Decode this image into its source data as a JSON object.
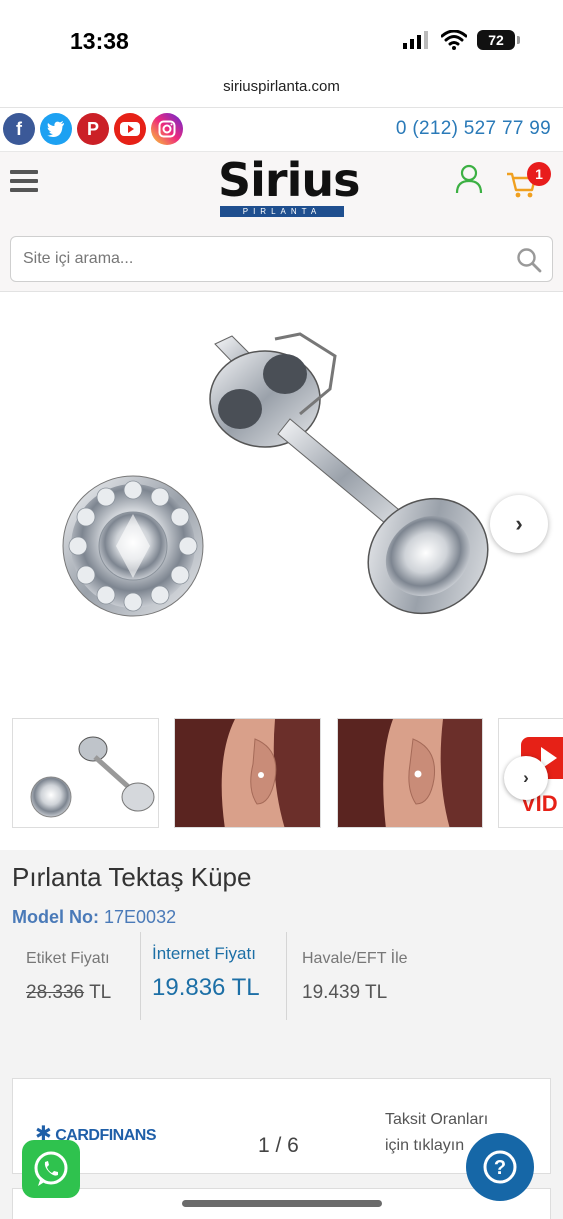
{
  "status": {
    "time": "13:38",
    "battery": "72"
  },
  "browser": {
    "url": "siriuspirlanta.com"
  },
  "topbar": {
    "social": [
      "facebook-icon",
      "twitter-icon",
      "pinterest-icon",
      "youtube-icon",
      "instagram-icon"
    ],
    "phone": "0 (212) 527 77 99"
  },
  "header": {
    "logo_text": "Sirius",
    "logo_sub": "PIRLANTA",
    "cart_count": "1",
    "search_placeholder": "Site içi arama..."
  },
  "product": {
    "title": "Pırlanta Tektaş Küpe",
    "model_label": "Model No:",
    "model_value": "17E0032",
    "prices": {
      "label_price_label": "Etiket Fiyatı",
      "label_price_value": "28.336",
      "label_price_currency": "TL",
      "internet_price_label": "İnternet Fiyatı",
      "internet_price_value": "19.836 TL",
      "transfer_price_label": "Havale/EFT İle",
      "transfer_price_value": "19.439 TL"
    }
  },
  "installment": {
    "card": "CARDFINANS",
    "text_line1": "Taksit Oranları",
    "text_line2": "için tıklayın",
    "page": "1 / 6"
  },
  "colors": {
    "accent": "#1c6fa6",
    "facebook": "#3b5998",
    "twitter": "#1da1f2",
    "pinterest": "#cb2027",
    "youtube": "#e62117",
    "whatsapp": "#2fc24e",
    "cart_badge": "#e81c1c"
  }
}
